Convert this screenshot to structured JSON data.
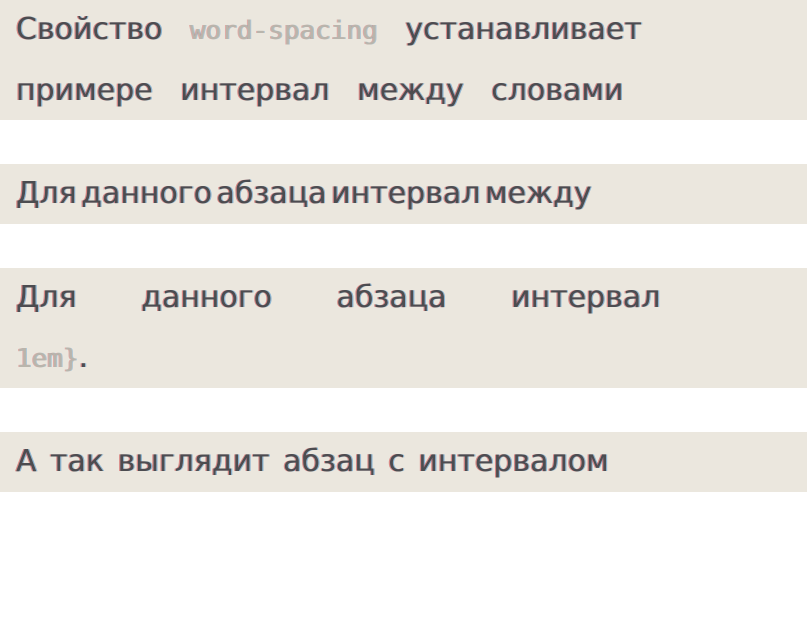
{
  "p1": {
    "pre1": "Свойство ",
    "code": "word-spacing",
    "post1": " устанавливает",
    "line2": "примере интервал между словами"
  },
  "p2": {
    "text": "Для данного абзаца интервал между"
  },
  "p3": {
    "line1": "Для данного абзаца интервал",
    "code": "1em}",
    "codeAfter": "."
  },
  "p4": {
    "text": "А так выглядит абзац с интервалом"
  }
}
